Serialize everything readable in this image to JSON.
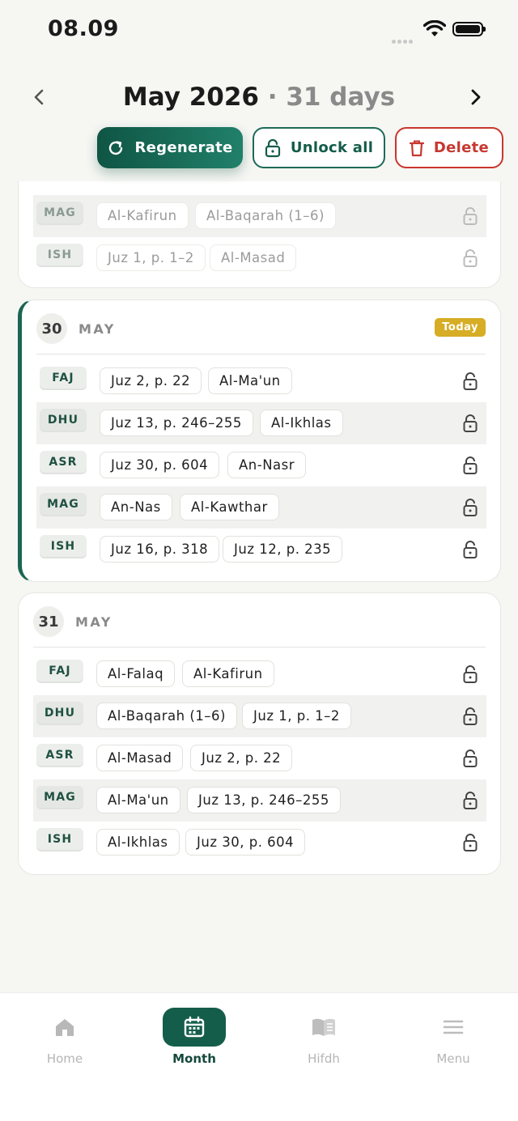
{
  "status": {
    "time": "08.09"
  },
  "header": {
    "month": "May 2026",
    "separator": "·",
    "days": "31 days"
  },
  "actions": {
    "regenerate": "Regenerate",
    "unlock_all": "Unlock all",
    "delete": "Delete"
  },
  "colors": {
    "accent": "#155d4b",
    "danger": "#c6382f",
    "today": "#d6ad25"
  },
  "partial_day": {
    "rows": [
      {
        "prayer": "MAG",
        "items": [
          "Al-Kafirun",
          "Al-Baqarah (1–6)"
        ]
      },
      {
        "prayer": "ISH",
        "items": [
          "Juz 1, p. 1–2",
          "Al-Masad"
        ]
      }
    ]
  },
  "days": [
    {
      "day": "30",
      "month": "MAY",
      "badge": "Today",
      "rows": [
        {
          "prayer": "FAJ",
          "items": [
            "Juz 2, p. 22",
            "Al-Ma'un"
          ]
        },
        {
          "prayer": "DHU",
          "items": [
            "Juz 13, p. 246–255",
            "Al-Ikhlas"
          ]
        },
        {
          "prayer": "ASR",
          "items": [
            "Juz 30, p. 604",
            "An-Nasr"
          ]
        },
        {
          "prayer": "MAG",
          "items": [
            "An-Nas",
            "Al-Kawthar"
          ]
        },
        {
          "prayer": "ISH",
          "items": [
            "Juz 16, p. 318",
            "Juz 12, p. 235"
          ]
        }
      ]
    },
    {
      "day": "31",
      "month": "MAY",
      "rows": [
        {
          "prayer": "FAJ",
          "items": [
            "Al-Falaq",
            "Al-Kafirun"
          ]
        },
        {
          "prayer": "DHU",
          "items": [
            "Al-Baqarah (1–6)",
            "Juz 1, p. 1–2"
          ]
        },
        {
          "prayer": "ASR",
          "items": [
            "Al-Masad",
            "Juz 2, p. 22"
          ]
        },
        {
          "prayer": "MAG",
          "items": [
            "Al-Ma'un",
            "Juz 13, p. 246–255"
          ]
        },
        {
          "prayer": "ISH",
          "items": [
            "Al-Ikhlas",
            "Juz 30, p. 604"
          ]
        }
      ]
    }
  ],
  "nav": {
    "home": "Home",
    "month": "Month",
    "hifdh": "Hifdh",
    "menu": "Menu"
  }
}
